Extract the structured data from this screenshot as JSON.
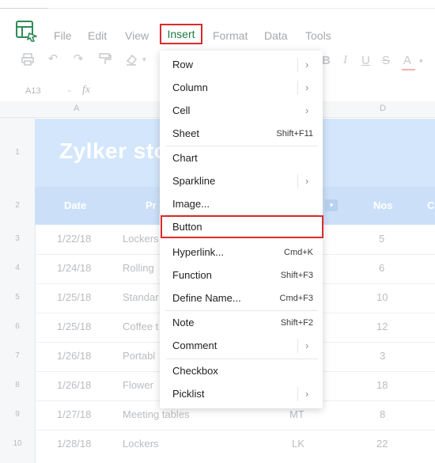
{
  "menubar": {
    "items": [
      "File",
      "Edit",
      "View",
      "Insert",
      "Format",
      "Data",
      "Tools"
    ],
    "active": "Insert"
  },
  "toolbar": {
    "bold": "B",
    "italic": "I",
    "underline": "U",
    "strike": "S",
    "fontcolor": "A"
  },
  "formula_bar": {
    "cell_ref": "A13",
    "fx": "fx"
  },
  "columns": {
    "A": "A",
    "D": "D"
  },
  "sheet": {
    "title": "Zylker sto",
    "headers": {
      "date": "Date",
      "product": "Pr",
      "nos": "Nos",
      "next": "C"
    },
    "rows": [
      {
        "num": "1"
      },
      {
        "num": "2"
      },
      {
        "num": "3",
        "date": "1/22/18",
        "product": "Lockers",
        "code": "",
        "nos": "5"
      },
      {
        "num": "4",
        "date": "1/24/18",
        "product": "Rolling",
        "code": "",
        "nos": "6"
      },
      {
        "num": "5",
        "date": "1/25/18",
        "product": "Standar",
        "code": "",
        "nos": "10"
      },
      {
        "num": "6",
        "date": "1/25/18",
        "product": "Coffee t",
        "code": "",
        "nos": "12"
      },
      {
        "num": "7",
        "date": "1/26/18",
        "product": "Portabl",
        "code": "",
        "nos": "3"
      },
      {
        "num": "8",
        "date": "1/26/18",
        "product": "Flower",
        "code": "",
        "nos": "18"
      },
      {
        "num": "9",
        "date": "1/27/18",
        "product": "Meeting tables",
        "code": "MT",
        "nos": "8"
      },
      {
        "num": "10",
        "date": "1/28/18",
        "product": "Lockers",
        "code": "LK",
        "nos": "22"
      }
    ]
  },
  "insert_menu": {
    "row": "Row",
    "column": "Column",
    "cell": "Cell",
    "sheet": "Sheet",
    "sheet_sc": "Shift+F11",
    "chart": "Chart",
    "sparkline": "Sparkline",
    "image": "Image...",
    "button": "Button",
    "hyperlink": "Hyperlink...",
    "hyperlink_sc": "Cmd+K",
    "function": "Function",
    "function_sc": "Shift+F3",
    "define_name": "Define Name...",
    "define_name_sc": "Cmd+F3",
    "note": "Note",
    "note_sc": "Shift+F2",
    "comment": "Comment",
    "checkbox": "Checkbox",
    "picklist": "Picklist",
    "arrow": "›"
  },
  "colors": {
    "accent_green": "#1e7c43",
    "highlight_red": "#d92b2b",
    "header_blue": "#cbe0f8"
  }
}
